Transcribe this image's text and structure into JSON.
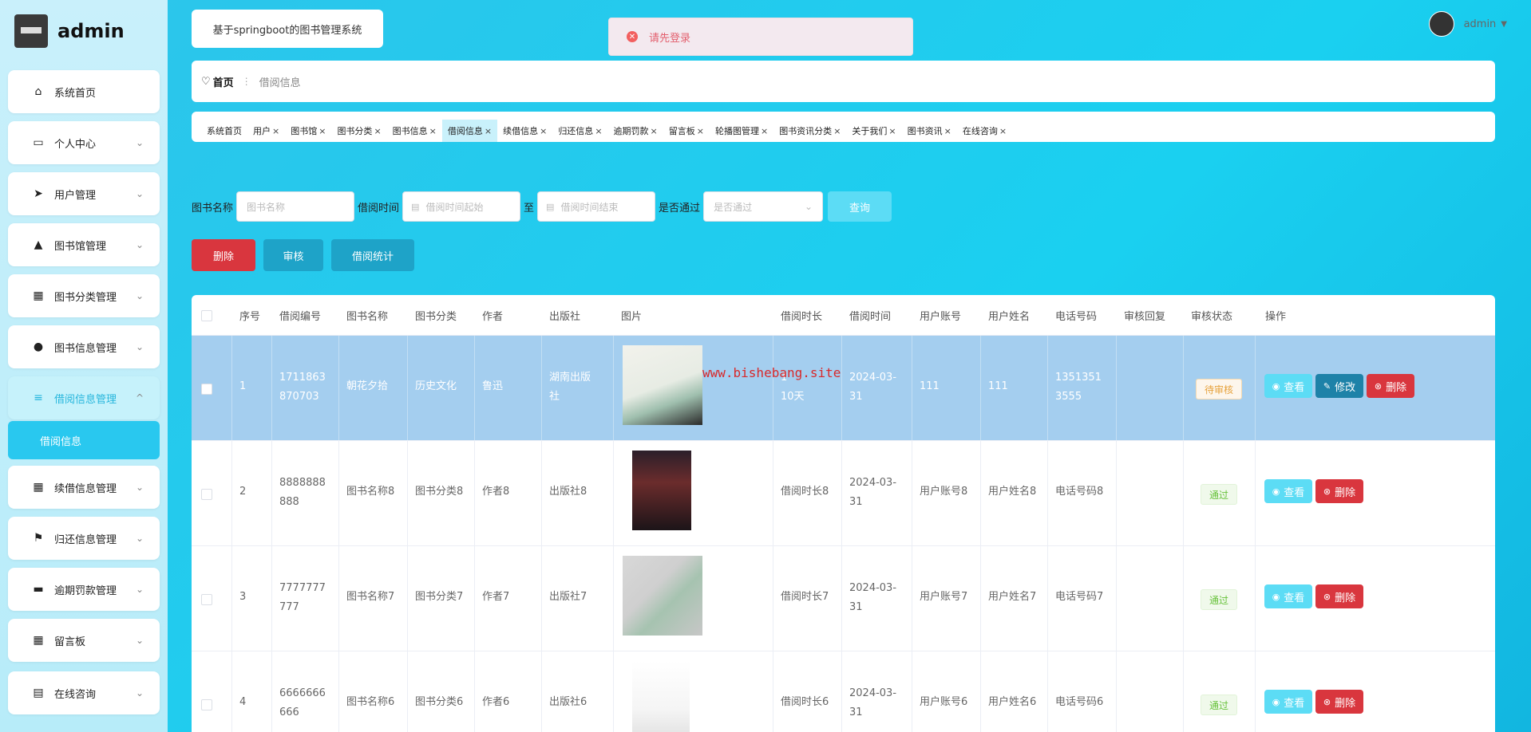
{
  "brand": {
    "name": "admin"
  },
  "sidebar": {
    "items": [
      {
        "label": "系统首页",
        "icon": "home-icon",
        "expand": false
      },
      {
        "label": "个人中心",
        "icon": "calendar-icon",
        "expand": true
      },
      {
        "label": "用户管理",
        "icon": "send-icon",
        "expand": true
      },
      {
        "label": "图书馆管理",
        "icon": "chart-icon",
        "expand": true
      },
      {
        "label": "图书分类管理",
        "icon": "grid-icon",
        "expand": true
      },
      {
        "label": "图书信息管理",
        "icon": "user-icon",
        "expand": true
      },
      {
        "label": "借阅信息管理",
        "icon": "list-icon",
        "expand": true,
        "active": true
      },
      {
        "label": "续借信息管理",
        "icon": "grid-icon",
        "expand": true
      },
      {
        "label": "归还信息管理",
        "icon": "flag-icon",
        "expand": true
      },
      {
        "label": "逾期罚款管理",
        "icon": "briefcase-icon",
        "expand": true
      },
      {
        "label": "留言板",
        "icon": "grid-icon",
        "expand": true
      },
      {
        "label": "在线咨询",
        "icon": "doc-icon",
        "expand": true
      }
    ],
    "sub_item": "借阅信息"
  },
  "header": {
    "system_title": "基于springboot的图书管理系统",
    "toast": "请先登录",
    "username": "admin"
  },
  "breadcrumb": {
    "home": "首页",
    "current": "借阅信息"
  },
  "tabs": [
    {
      "label": "系统首页",
      "closable": false
    },
    {
      "label": "用户",
      "closable": true
    },
    {
      "label": "图书馆",
      "closable": true
    },
    {
      "label": "图书分类",
      "closable": true
    },
    {
      "label": "图书信息",
      "closable": true
    },
    {
      "label": "借阅信息",
      "closable": true,
      "active": true
    },
    {
      "label": "续借信息",
      "closable": true
    },
    {
      "label": "归还信息",
      "closable": true
    },
    {
      "label": "逾期罚款",
      "closable": true
    },
    {
      "label": "留言板",
      "closable": true
    },
    {
      "label": "轮播图管理",
      "closable": true
    },
    {
      "label": "图书资讯分类",
      "closable": true
    },
    {
      "label": "关于我们",
      "closable": true
    },
    {
      "label": "图书资讯",
      "closable": true
    },
    {
      "label": "在线咨询",
      "closable": true
    }
  ],
  "search": {
    "book_name_label": "图书名称",
    "book_name_placeholder": "图书名称",
    "borrow_time_label": "借阅时间",
    "start_placeholder": "借阅时间起始",
    "to_label": "至",
    "end_placeholder": "借阅时间结束",
    "pass_label": "是否通过",
    "pass_placeholder": "是否通过",
    "query_button": "查询"
  },
  "actions": {
    "delete": "删除",
    "review": "审核",
    "stats": "借阅统计"
  },
  "table": {
    "headers": [
      "序号",
      "借阅编号",
      "图书名称",
      "图书分类",
      "作者",
      "出版社",
      "图片",
      "借阅时长",
      "借阅时间",
      "用户账号",
      "用户姓名",
      "电话号码",
      "审核回复",
      "审核状态",
      "操作"
    ],
    "rows": [
      {
        "idx": "1",
        "no_a": "1711863",
        "no_b": "870703",
        "name": "朝花夕拾",
        "cat": "历史文化",
        "author": "鲁迅",
        "pub_a": "湖南出版",
        "pub_b": "社",
        "dur_a": "1",
        "dur_b": "10天",
        "time_a": "2024-03-",
        "time_b": "31",
        "account": "111",
        "uname": "111",
        "phone_a": "1351351",
        "phone_b": "3555",
        "reply": "",
        "status": "待审核",
        "status_type": "pending",
        "ops": [
          "查看",
          "修改",
          "删除"
        ]
      },
      {
        "idx": "2",
        "no_a": "8888888",
        "no_b": "888",
        "name": "图书名称8",
        "cat": "图书分类8",
        "author": "作者8",
        "pub_a": "出版社8",
        "pub_b": "",
        "dur_a": "借阅时长8",
        "dur_b": "",
        "time_a": "2024-03-",
        "time_b": "31",
        "account": "用户账号8",
        "uname": "用户姓名8",
        "phone_a": "电话号码8",
        "phone_b": "",
        "reply": "",
        "status": "通过",
        "status_type": "pass",
        "ops": [
          "查看",
          "删除"
        ]
      },
      {
        "idx": "3",
        "no_a": "7777777",
        "no_b": "777",
        "name": "图书名称7",
        "cat": "图书分类7",
        "author": "作者7",
        "pub_a": "出版社7",
        "pub_b": "",
        "dur_a": "借阅时长7",
        "dur_b": "",
        "time_a": "2024-03-",
        "time_b": "31",
        "account": "用户账号7",
        "uname": "用户姓名7",
        "phone_a": "电话号码7",
        "phone_b": "",
        "reply": "",
        "status": "通过",
        "status_type": "pass",
        "ops": [
          "查看",
          "删除"
        ]
      },
      {
        "idx": "4",
        "no_a": "6666666",
        "no_b": "666",
        "name": "图书名称6",
        "cat": "图书分类6",
        "author": "作者6",
        "pub_a": "出版社6",
        "pub_b": "",
        "dur_a": "借阅时长6",
        "dur_b": "",
        "time_a": "2024-03-",
        "time_b": "31",
        "account": "用户账号6",
        "uname": "用户姓名6",
        "phone_a": "电话号码6",
        "phone_b": "",
        "reply": "",
        "status": "通过",
        "status_type": "pass",
        "ops": [
          "查看",
          "删除"
        ]
      }
    ]
  },
  "watermark": "www.bishebang.site",
  "colors": {
    "accent": "#29c8ef",
    "danger": "#d9363e",
    "primary_dark": "#1ea3c8",
    "selected_row": "#a4ceef"
  }
}
